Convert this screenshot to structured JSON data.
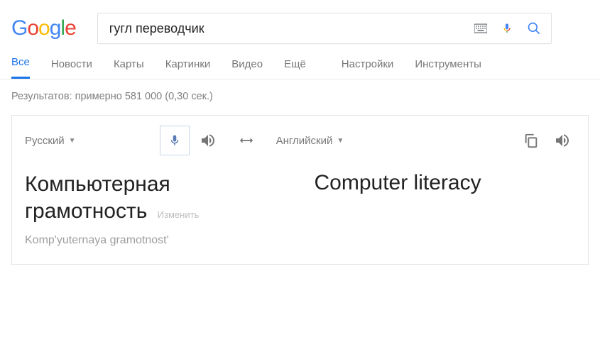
{
  "logo_letters": [
    "G",
    "o",
    "o",
    "g",
    "l",
    "e"
  ],
  "search": {
    "value": "гугл переводчик"
  },
  "tabs": [
    {
      "label": "Все",
      "active": true
    },
    {
      "label": "Новости",
      "active": false
    },
    {
      "label": "Карты",
      "active": false
    },
    {
      "label": "Картинки",
      "active": false
    },
    {
      "label": "Видео",
      "active": false
    },
    {
      "label": "Ещё",
      "active": false
    },
    {
      "label": "Настройки",
      "active": false
    },
    {
      "label": "Инструменты",
      "active": false
    }
  ],
  "stats": "Результатов: примерно 581 000 (0,30 сек.)",
  "translate": {
    "src_lang": "Русский",
    "dst_lang": "Английский",
    "src_text": "Компьютерная грамотность",
    "edit_label": "Изменить",
    "translit": "Komp'yuternaya gramotnost'",
    "dst_text": "Computer literacy"
  }
}
